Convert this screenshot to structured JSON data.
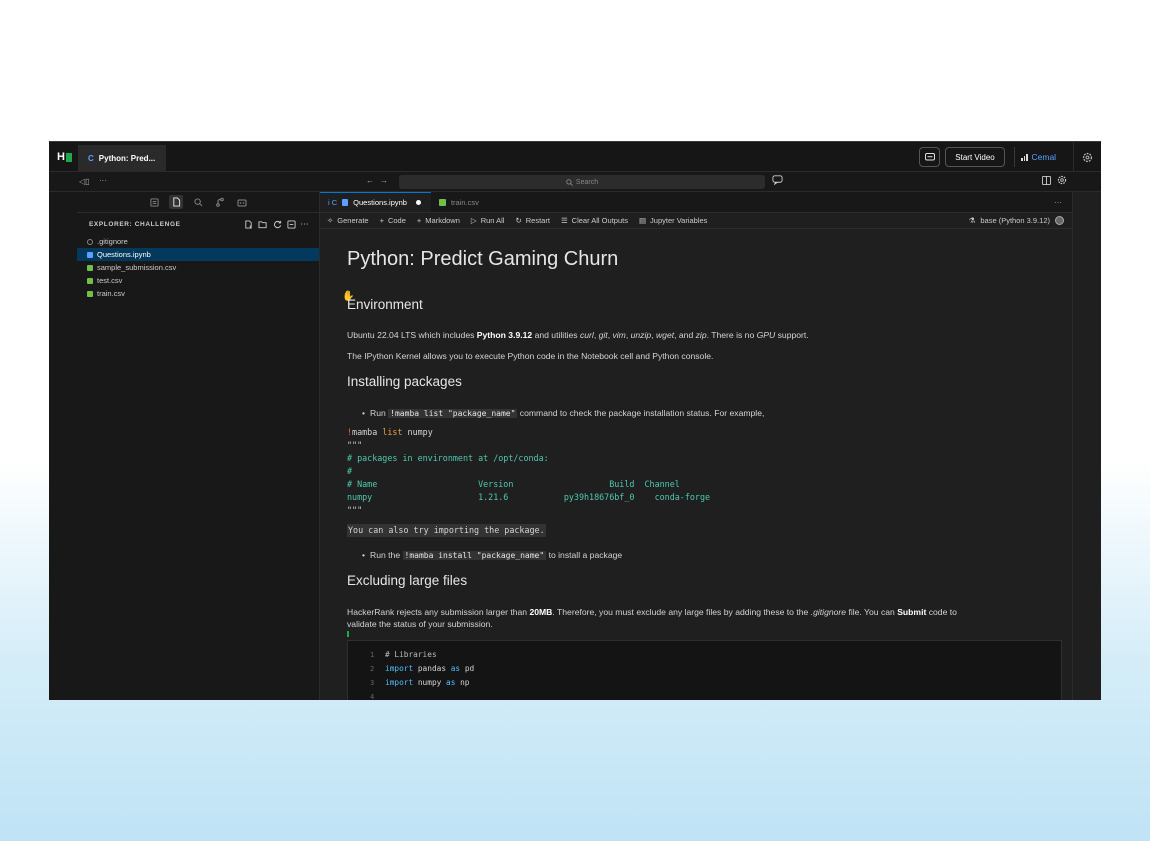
{
  "app": {
    "logo_text": "H",
    "tab_letter": "C",
    "tab_title": "Python: Pred...",
    "start_video": "Start Video",
    "user_name": "Cemal"
  },
  "nav": {
    "search_placeholder": "Search",
    "more": "···"
  },
  "sidebar": {
    "header": "EXPLORER: CHALLENGE",
    "more": "···",
    "files": [
      {
        "name": ".gitignore",
        "icon": "gear-icon",
        "color": "#888888"
      },
      {
        "name": "Questions.ipynb",
        "icon": "notebook-icon",
        "color": "#5aa0ff"
      },
      {
        "name": "sample_submission.csv",
        "icon": "csv-icon",
        "color": "#6fbf4a"
      },
      {
        "name": "test.csv",
        "icon": "csv-icon",
        "color": "#6fbf4a"
      },
      {
        "name": "train.csv",
        "icon": "csv-icon",
        "color": "#6fbf4a"
      }
    ]
  },
  "tabs": [
    {
      "prefix": "i C",
      "label": "Questions.ipynb"
    },
    {
      "prefix": "",
      "label": "train.csv"
    }
  ],
  "toolbar": {
    "generate": "Generate",
    "code": "Code",
    "markdown": "Markdown",
    "run_all": "Run All",
    "restart": "Restart",
    "clear": "Clear All Outputs",
    "variables": "Jupyter Variables",
    "kernel": "base (Python 3.9.12)",
    "more": "···"
  },
  "notebook": {
    "title": "Python: Predict Gaming Churn",
    "env_heading": "Environment",
    "env_p1_a": "Ubuntu 22.04 LTS which includes ",
    "env_p1_b": "Python 3.9.12",
    "env_p1_c": " and utilities ",
    "env_p1_d": "curl",
    "env_p1_e": ", ",
    "env_p1_f": "git",
    "env_p1_g": ", ",
    "env_p1_h": "vim",
    "env_p1_i": ", ",
    "env_p1_j": "unzip",
    "env_p1_k": ", ",
    "env_p1_l": "wget",
    "env_p1_m": ", and ",
    "env_p1_n": "zip",
    "env_p1_o": ". There is no ",
    "env_p1_p": "GPU",
    "env_p1_q": " support.",
    "env_p2": "The IPython Kernel allows you to execute Python code in the Notebook cell and Python console.",
    "install_heading": "Installing packages",
    "install_b1_a": "Run ",
    "install_b1_code": "!mamba list \"package_name\"",
    "install_b1_c": " command to check the package installation status. For example,",
    "code_bang": "!",
    "code_mamba": "mamba",
    "code_list": "list",
    "code_pkg": "numpy",
    "code_q1": "\"\"\"",
    "code_c1": "# packages in environment at /opt/conda:",
    "code_c2": "#",
    "code_c3": "# Name                    Version                   Build  Channel",
    "code_c4": "numpy                     1.21.6           py39h18676bf_0    conda-forge",
    "code_q2": "\"\"\"",
    "also": "You can also try importing the package.",
    "install_b2_a": "Run the ",
    "install_b2_code": "!mamba install \"package_name\"",
    "install_b2_c": " to install a package",
    "exclude_heading": "Excluding large files",
    "exclude_a": "HackerRank rejects any submission larger than ",
    "exclude_b": "20MB",
    "exclude_c": ". Therefore, you must exclude any large files by adding these to the ",
    "exclude_d": ".gitignore",
    "exclude_e": " file. You can ",
    "exclude_f": "Submit",
    "exclude_g": " code to",
    "exclude_line2": "validate the status of your submission.",
    "cell_lines": [
      {
        "n": "1",
        "t": "# Libraries"
      },
      {
        "n": "2",
        "kw": "import",
        "t1": " pandas ",
        "kw2": "as",
        "t2": " pd"
      },
      {
        "n": "3",
        "kw": "import",
        "t1": " numpy ",
        "kw2": "as",
        "t2": " np"
      },
      {
        "n": "4"
      }
    ]
  }
}
